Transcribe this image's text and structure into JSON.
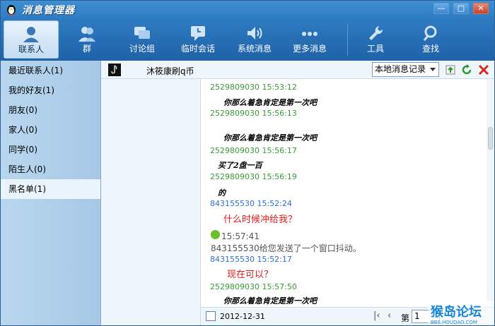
{
  "window": {
    "title": "消息管理器",
    "min_symbol": "—",
    "max_symbol": "□",
    "close_symbol": "✕"
  },
  "toolbar": {
    "items": [
      {
        "label": "联系人",
        "icon": "contacts-icon",
        "active": true
      },
      {
        "label": "群",
        "icon": "group-icon"
      },
      {
        "label": "讨论组",
        "icon": "discussion-icon"
      },
      {
        "label": "临时会话",
        "icon": "temp-chat-icon"
      },
      {
        "label": "系统消息",
        "icon": "system-message-icon"
      },
      {
        "label": "更多消息",
        "icon": "more-messages-icon"
      },
      {
        "label": "工具",
        "icon": "wrench-icon"
      },
      {
        "label": "查找",
        "icon": "search-icon"
      }
    ]
  },
  "sidebar": {
    "items": [
      {
        "label": "最近联系人(1)"
      },
      {
        "label": "我的好友(1)"
      },
      {
        "label": "朋友(0)"
      },
      {
        "label": "家人(0)"
      },
      {
        "label": "同学(0)"
      },
      {
        "label": "陌生人(0)"
      },
      {
        "label": "黑名单(1)",
        "selected": true
      }
    ]
  },
  "chat_header": {
    "contact_name": "沐筱康刷q币",
    "history_select": "本地消息记录"
  },
  "messages": [
    {
      "meta": "2529809030  15:53:12",
      "meta_color": "green",
      "body": "你那么着急肯定是第一次吧",
      "style": "italic"
    },
    {
      "meta": "2529809030  15:56:13",
      "meta_color": "green",
      "body": "你那么着急肯定是第一次吧",
      "style": "italic"
    },
    {
      "meta": "2529809030  15:56:17",
      "meta_color": "green",
      "body": "买了2盘一百",
      "style": "italic"
    },
    {
      "meta": "2529809030  15:56:19",
      "meta_color": "green",
      "body": "的",
      "style": "italic"
    },
    {
      "meta": "843155530  15:52:24",
      "meta_color": "blue",
      "body": "什么时候冲给我？",
      "style": "red"
    },
    {
      "meta": "843155530  15:52:17",
      "meta_color": "blue",
      "body": "现在可以？",
      "style": "red"
    },
    {
      "meta": "2529809030  15:57:50",
      "meta_color": "green",
      "body": "你那么着急肯定是第一次吧",
      "style": "italic"
    }
  ],
  "shake_notice": {
    "time": "15:57:41",
    "text": "843155530给您发送了一个窗口抖动。"
  },
  "footer": {
    "date": "2012-12-31",
    "page_label": "第",
    "page_value": "1",
    "first_symbol": "|‹",
    "prev_symbol": "‹"
  },
  "colors": {
    "titlebar": "#3f8fd2",
    "toolbar": "#2f7cc2",
    "sidebar": "#b9d6ee",
    "meta_green": "#3a9a3a",
    "meta_blue": "#2c6fd6",
    "red_text": "#e21b1b"
  }
}
